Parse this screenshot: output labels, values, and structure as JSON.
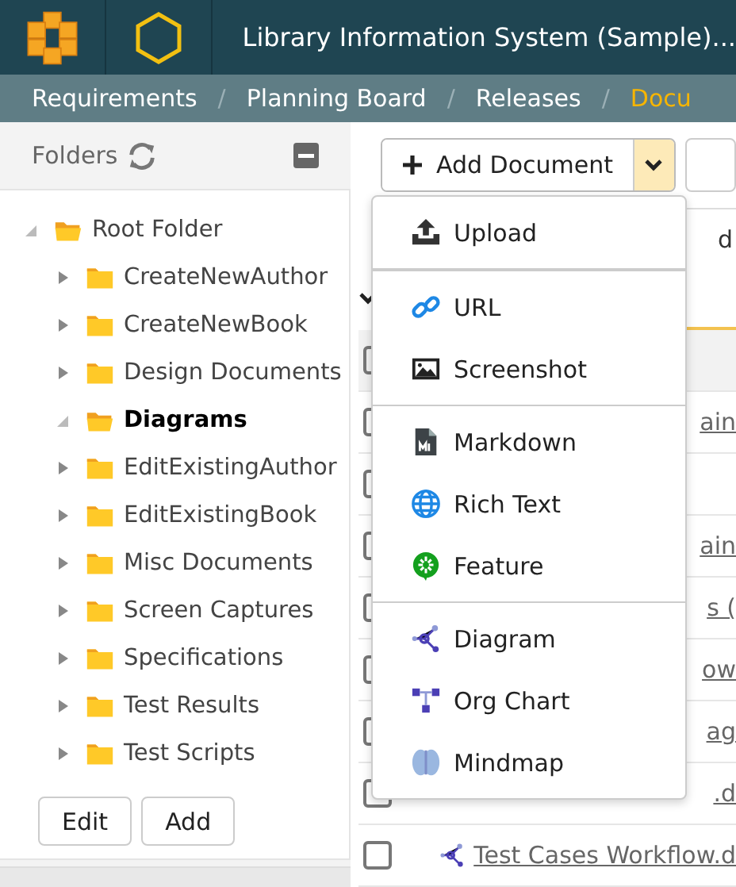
{
  "header": {
    "title": "Library Information System (Sample)..."
  },
  "breadcrumbs": [
    {
      "label": "Requirements",
      "selected": false
    },
    {
      "separator": "/",
      "label": "Planning Board",
      "selected": false
    },
    {
      "separator": "/",
      "label": "Releases",
      "selected": false
    },
    {
      "separator": "/",
      "label": "Docu",
      "selected": true
    }
  ],
  "folders": {
    "title": "Folders",
    "tree": [
      {
        "label": "Root Folder",
        "expanded": true,
        "selected": false,
        "children": [
          {
            "label": "CreateNewAuthor",
            "expanded": false,
            "selected": false
          },
          {
            "label": "CreateNewBook",
            "expanded": false,
            "selected": false
          },
          {
            "label": "Design Documents",
            "expanded": false,
            "selected": false
          },
          {
            "label": "Diagrams",
            "expanded": true,
            "selected": true
          },
          {
            "label": "EditExistingAuthor",
            "expanded": false,
            "selected": false
          },
          {
            "label": "EditExistingBook",
            "expanded": false,
            "selected": false
          },
          {
            "label": "Misc Documents",
            "expanded": false,
            "selected": false
          },
          {
            "label": "Screen Captures",
            "expanded": false,
            "selected": false
          },
          {
            "label": "Specifications",
            "expanded": false,
            "selected": false
          },
          {
            "label": "Test Results",
            "expanded": false,
            "selected": false
          },
          {
            "label": "Test Scripts",
            "expanded": false,
            "selected": false
          }
        ]
      }
    ],
    "buttons": [
      "Edit",
      "Add"
    ]
  },
  "add_document": {
    "label": "Add Document",
    "expanded": true,
    "menu": [
      [
        {
          "label": "Upload",
          "kind": "upload"
        }
      ],
      [
        {
          "label": "URL",
          "kind": "link"
        },
        {
          "label": "Screenshot",
          "kind": "image"
        }
      ],
      [
        {
          "label": "Markdown",
          "kind": "markdown"
        },
        {
          "label": "Rich Text",
          "kind": "globe"
        },
        {
          "label": "Feature",
          "kind": "feature"
        }
      ],
      [
        {
          "label": "Diagram",
          "kind": "diagram"
        },
        {
          "label": "Org Chart",
          "kind": "org"
        },
        {
          "label": "Mindmap",
          "kind": "brain"
        }
      ]
    ]
  },
  "table": {
    "header_fragment": "d",
    "rows": [
      {
        "checked": false
      },
      {
        "checked": false,
        "text": "ain"
      },
      {
        "checked": false
      },
      {
        "checked": false,
        "text": "ain"
      },
      {
        "checked": false,
        "text": "s ("
      },
      {
        "checked": false,
        "text": "ow"
      },
      {
        "checked": false,
        "text": "ag"
      },
      {
        "checked": false,
        "text": ".d"
      },
      {
        "checked": false,
        "text": "Test Cases Workflow.d",
        "kind": "diagram"
      }
    ]
  }
}
